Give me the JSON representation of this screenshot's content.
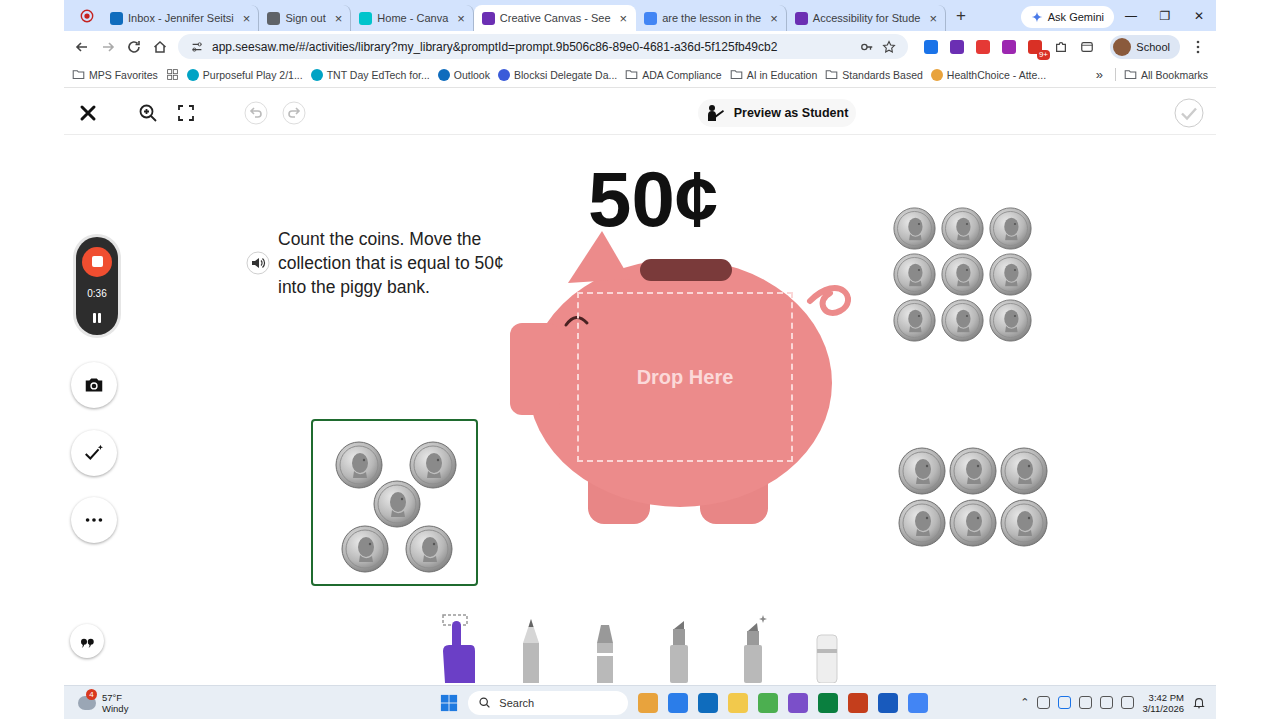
{
  "browser": {
    "tabs": [
      {
        "label": "Inbox - Jennifer Seitsi",
        "selected": false,
        "color": "#0f6cbd"
      },
      {
        "label": "Sign out",
        "selected": false,
        "color": "#5f6368"
      },
      {
        "label": "Home - Canva",
        "selected": false,
        "color": "#00c4cc"
      },
      {
        "label": "Creative Canvas - See",
        "selected": true,
        "color": "#6b2fb3"
      },
      {
        "label": "are the lesson in the",
        "selected": false,
        "color": "#4285f4"
      },
      {
        "label": "Accessibility for Stude",
        "selected": false,
        "color": "#6b2fb3"
      }
    ],
    "close": "×",
    "new_tab": "+",
    "gemini": "Ask Gemini",
    "window_controls": [
      "—",
      "❐",
      "✕"
    ],
    "url": "app.seesaw.me/#/activities/library?my_library&promptId=prompt.9b506c86-89e0-4681-a36d-5f125fb49cb2",
    "extension_badge": "9+",
    "profile": "School",
    "bookmarks": [
      {
        "label": "MPS Favorites",
        "kind": "folder",
        "color": "#5f6368"
      },
      {
        "label": "Purposeful Play 2/1...",
        "kind": "link",
        "color": "#00a3c4"
      },
      {
        "label": "TNT Day EdTech for...",
        "kind": "link",
        "color": "#00a3c4"
      },
      {
        "label": "Outlook",
        "kind": "link",
        "color": "#0f6cbd"
      },
      {
        "label": "Blocksi Delegate Da...",
        "kind": "link",
        "color": "#3a5bd9"
      },
      {
        "label": "ADA Compliance",
        "kind": "folder",
        "color": "#5f6368"
      },
      {
        "label": "AI in Education",
        "kind": "folder",
        "color": "#5f6368"
      },
      {
        "label": "Standards Based",
        "kind": "folder",
        "color": "#5f6368"
      },
      {
        "label": "HealthChoice - Atte...",
        "kind": "link",
        "color": "#e8a33d"
      }
    ],
    "bookmarks_more": "»",
    "all_bookmarks": "All Bookmarks"
  },
  "seesaw": {
    "preview": "Preview as Student",
    "price": "50¢",
    "instructions": "Count the coins. Move the collection that is equal to 50¢ into the piggy bank.",
    "drop_label": "Drop Here",
    "timer": "0:36",
    "collections": [
      {
        "count": 5,
        "selected": true
      },
      {
        "count": 9,
        "selected": false
      },
      {
        "count": 6,
        "selected": false
      }
    ],
    "tools": [
      {
        "kind": "hand",
        "selected": true
      },
      {
        "kind": "pencil",
        "selected": false
      },
      {
        "kind": "crayon",
        "selected": false
      },
      {
        "kind": "marker",
        "selected": false
      },
      {
        "kind": "highlighter",
        "selected": false
      },
      {
        "kind": "eraser",
        "selected": false
      }
    ]
  },
  "taskbar": {
    "weather_badge": "4",
    "temperature": "57°F",
    "weather": "Windy",
    "search": "Search",
    "time": "3:42 PM",
    "date": "3/11/2026"
  }
}
